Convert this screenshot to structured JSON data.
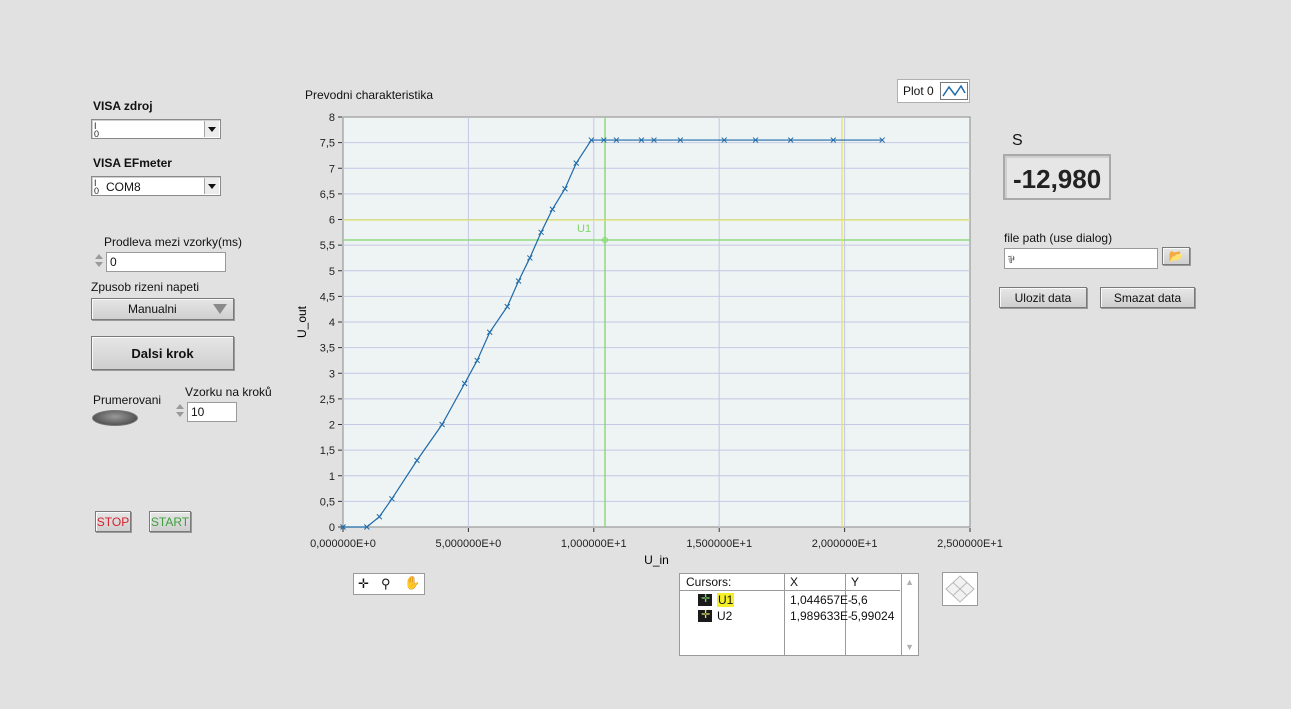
{
  "controls": {
    "visa_source_label": "VISA  zdroj",
    "visa_source_value": "",
    "visa_efmeter_label": "VISA EFmeter",
    "visa_efmeter_value": "COM8",
    "delay_label": "Prodleva mezi vzorky(ms)",
    "delay_value": "0",
    "voltage_mode_label": "Zpusob rizeni napeti",
    "voltage_mode_value": "Manualni",
    "next_step_button": "Dalsi krok",
    "averaging_label": "Prumerovani",
    "samples_label": "Vzorku na kroků",
    "samples_value": "10",
    "stop_button": "STOP",
    "start_button": "START"
  },
  "graph": {
    "title": "Prevodni charakteristika",
    "legend_label": "Plot 0",
    "cursor_label": "U1"
  },
  "cursor_table": {
    "headers": [
      "Cursors:",
      "X",
      "Y"
    ],
    "rows": [
      {
        "name": "U1",
        "x": "1,044657E-",
        "y": "5,6"
      },
      {
        "name": "U2",
        "x": "1,989633E-",
        "y": "5,99024"
      }
    ]
  },
  "right_panel": {
    "s_label": "S",
    "s_value": "-12,980",
    "file_path_label": "file path (use dialog)",
    "file_path_value": "",
    "save_button": "Ulozit data",
    "delete_button": "Smazat data"
  },
  "colors": {
    "plot_bg": "#eef3f3",
    "grid": "#c4c8e4",
    "series": "#1f6aa8",
    "cursor_u1": "#7fd66a",
    "cursor_u2": "#e4e46a"
  },
  "chart_data": {
    "type": "line",
    "title": "Prevodni charakteristika",
    "xlabel": "U_in",
    "ylabel": "U_out",
    "xlim": [
      0,
      25
    ],
    "ylim": [
      0,
      8
    ],
    "x_ticks": [
      "0,000000E+0",
      "5,000000E+0",
      "1,000000E+1",
      "1,500000E+1",
      "2,000000E+1",
      "2,500000E+1"
    ],
    "y_ticks": [
      "0",
      "0,5",
      "1",
      "1,5",
      "2",
      "2,5",
      "3",
      "3,5",
      "4",
      "4,5",
      "5",
      "5,5",
      "6",
      "6,5",
      "7",
      "7,5",
      "8"
    ],
    "grid": true,
    "legend": "top-right",
    "series": [
      {
        "name": "Plot 0",
        "x": [
          0,
          0.95,
          1.45,
          1.95,
          2.95,
          3.95,
          4.85,
          5.35,
          5.85,
          6.55,
          7.0,
          7.45,
          7.9,
          8.35,
          8.85,
          9.3,
          9.9,
          10.4,
          10.9,
          11.9,
          12.4,
          13.45,
          15.2,
          16.45,
          17.85,
          19.55,
          21.5
        ],
        "y": [
          0,
          0,
          0.2,
          0.55,
          1.3,
          2.0,
          2.8,
          3.25,
          3.8,
          4.3,
          4.8,
          5.25,
          5.75,
          6.2,
          6.6,
          7.1,
          7.55,
          7.55,
          7.55,
          7.55,
          7.55,
          7.55,
          7.55,
          7.55,
          7.55,
          7.55,
          7.55
        ]
      }
    ],
    "cursors": [
      {
        "name": "U1",
        "x": 10.44657,
        "y": 5.6
      },
      {
        "name": "U2",
        "x": 19.89633,
        "y": 5.99024
      }
    ]
  }
}
